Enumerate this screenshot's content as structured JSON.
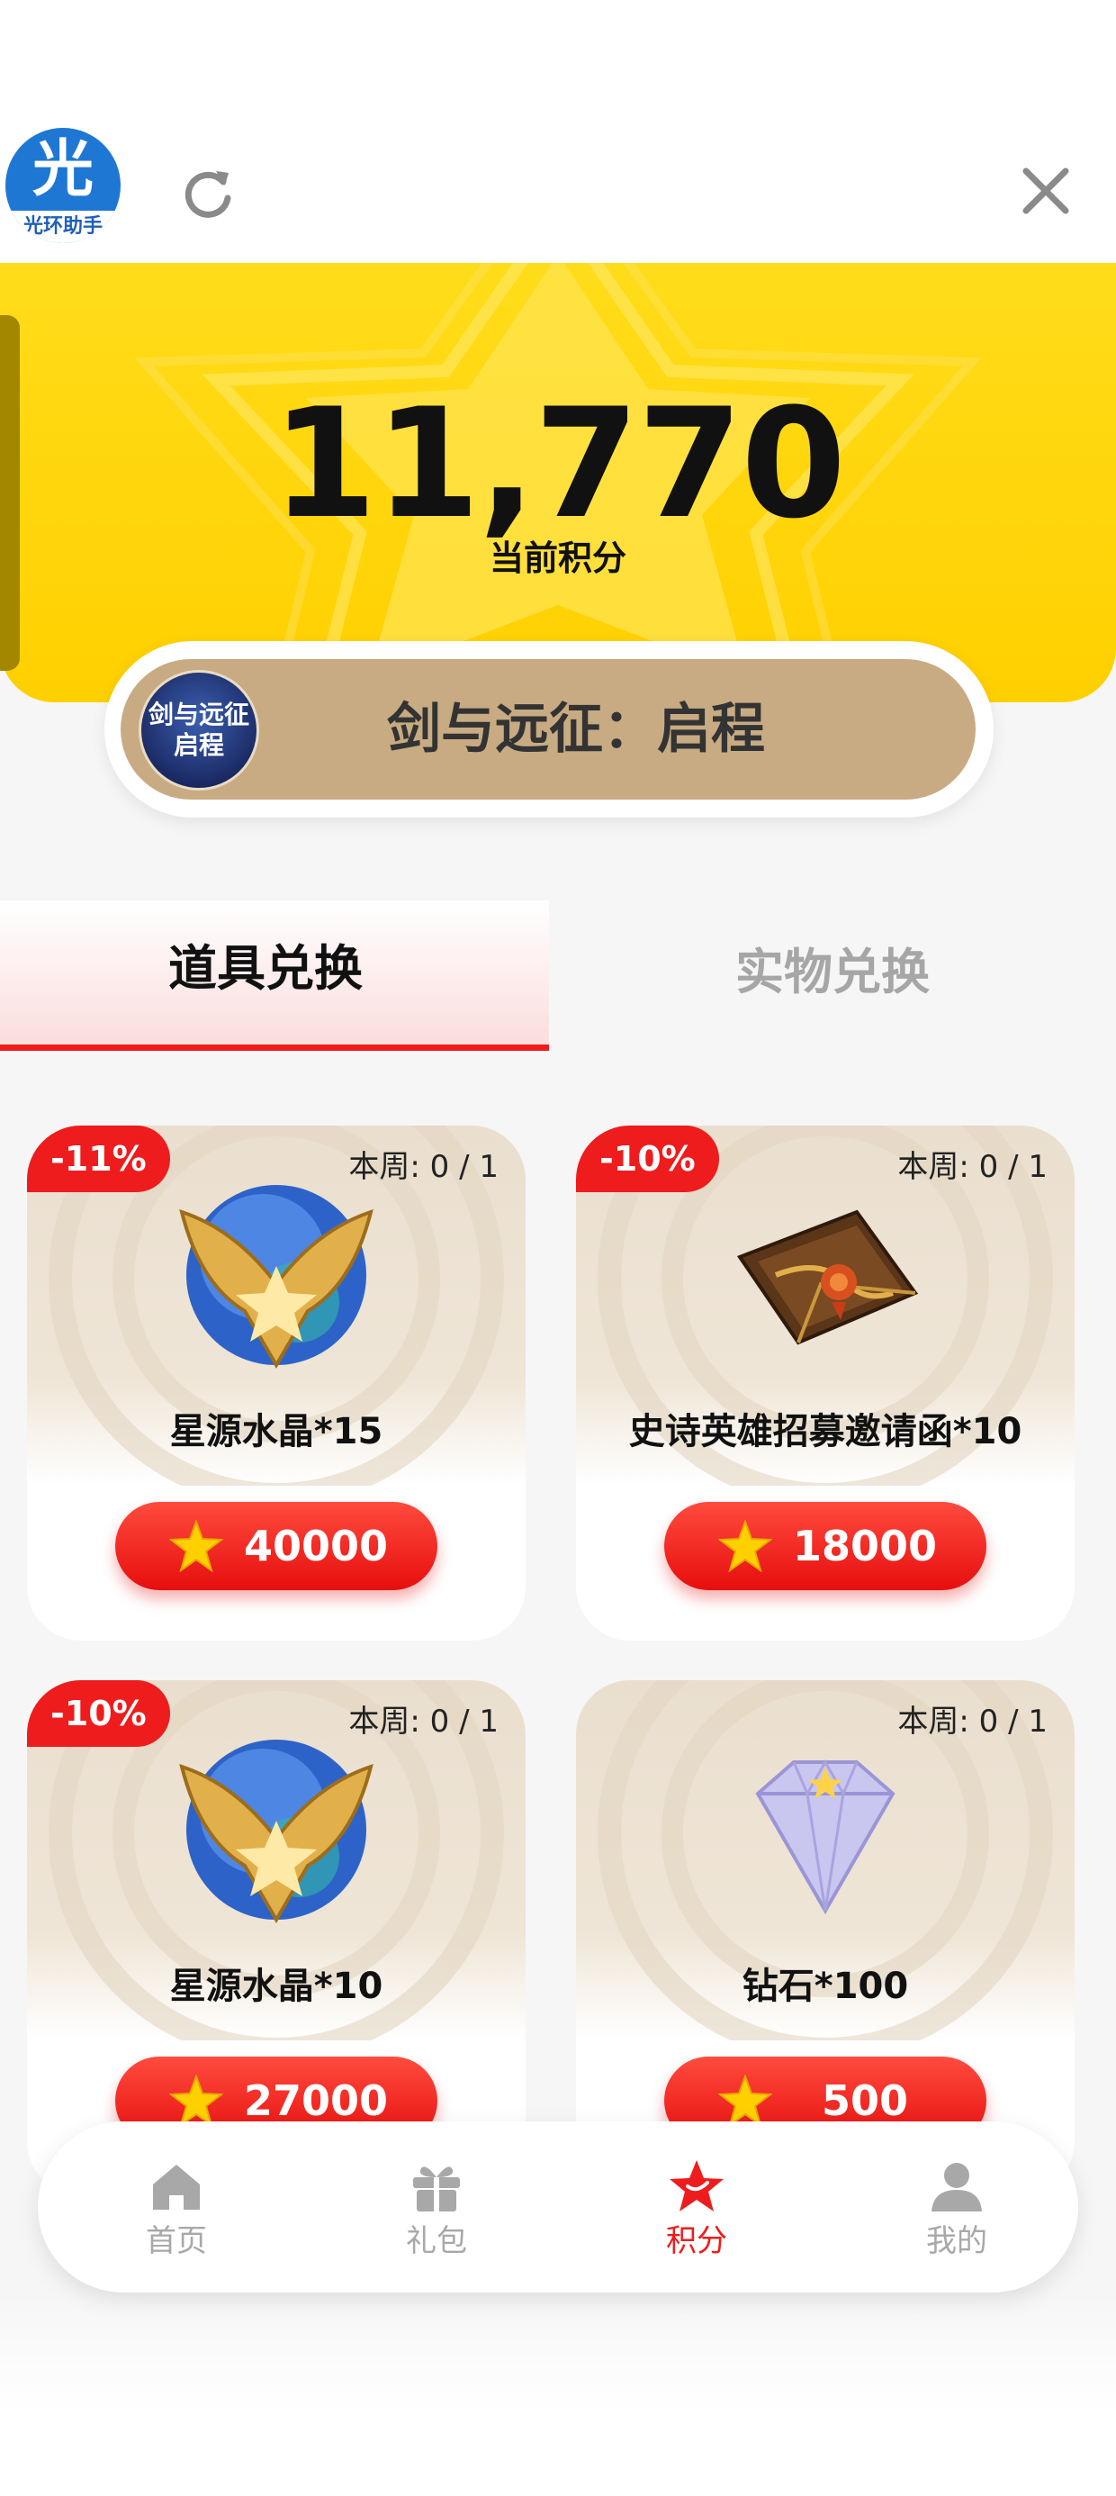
{
  "app": {
    "logo_char": "光",
    "logo_text": "光环助手"
  },
  "header": {
    "refresh_icon": "refresh-icon",
    "close_icon": "close-icon"
  },
  "points": {
    "value": "11,770",
    "label": "当前积分"
  },
  "game": {
    "name": "剑与远征：启程",
    "icon_text": "剑与远征启程"
  },
  "tabs": [
    {
      "label": "道具兑换",
      "active": true
    },
    {
      "label": "实物兑换",
      "active": false
    }
  ],
  "items": [
    {
      "discount": "-11%",
      "weekly": "本周: 0 / 1",
      "name": "星源水晶*15",
      "price": "40000",
      "icon": "star-crystal-icon"
    },
    {
      "discount": "-10%",
      "weekly": "本周: 0 / 1",
      "name": "史诗英雄招募邀请函*10",
      "price": "18000",
      "icon": "invitation-letter-icon"
    },
    {
      "discount": "-10%",
      "weekly": "本周: 0 / 1",
      "name": "星源水晶*10",
      "price": "27000",
      "icon": "star-crystal-icon"
    },
    {
      "discount": "",
      "weekly": "本周: 0 / 1",
      "name": "钻石*100",
      "price": "500",
      "icon": "diamond-icon"
    }
  ],
  "nav": [
    {
      "label": "首页",
      "icon": "home-icon",
      "active": false
    },
    {
      "label": "礼包",
      "icon": "gift-icon",
      "active": false
    },
    {
      "label": "积分",
      "icon": "star-icon",
      "active": true
    },
    {
      "label": "我的",
      "icon": "user-icon",
      "active": false
    }
  ],
  "colors": {
    "accent": "#ee1c1c",
    "banner": "#ffd000",
    "pill": "#c8ab83",
    "inactive": "#a8a8a8"
  }
}
